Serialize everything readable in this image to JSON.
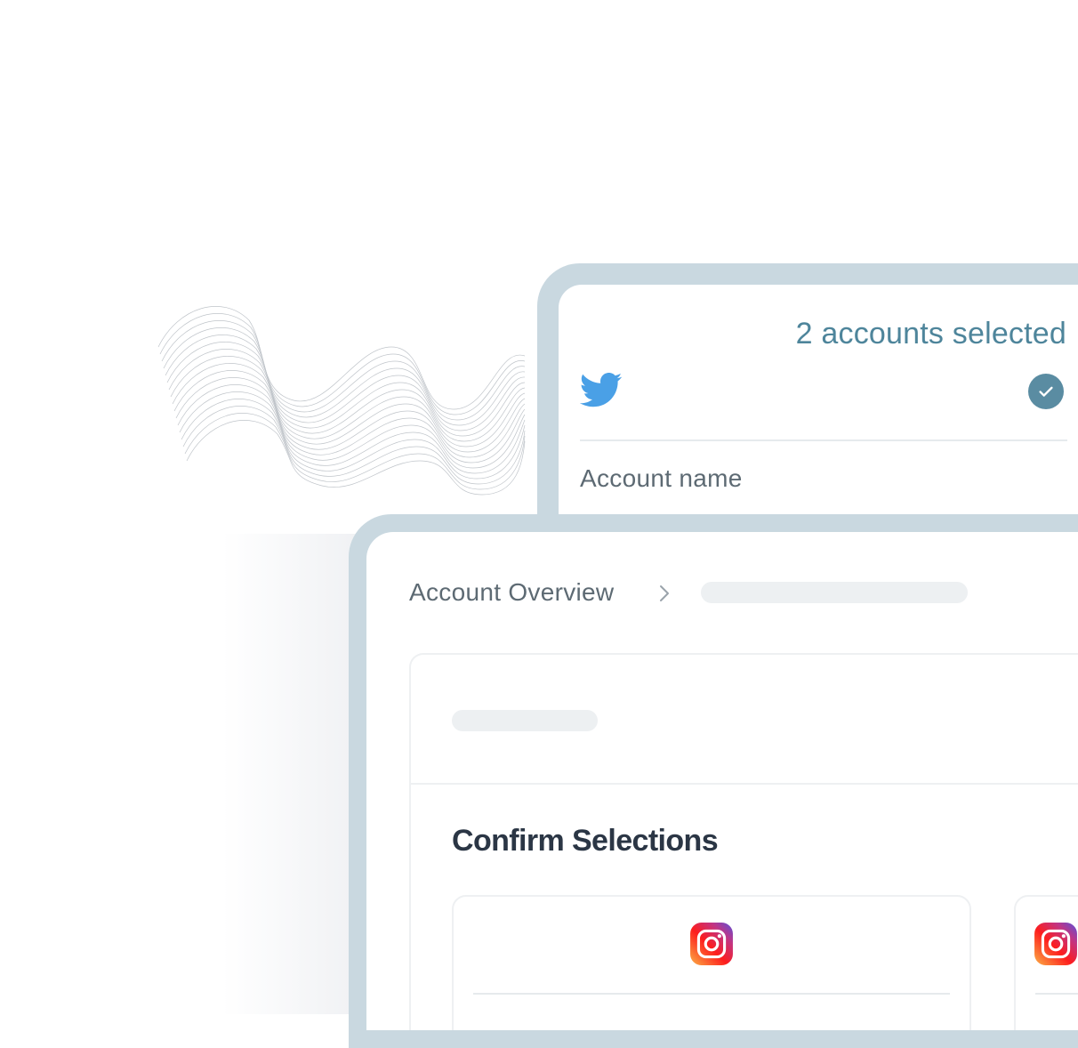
{
  "account_selector": {
    "selected_count_label": "2 accounts selected",
    "platform_icon": "twitter-bird-icon",
    "selected_icon": "checkmark-circle-icon",
    "account_name_label": "Account name"
  },
  "overview": {
    "breadcrumb": {
      "root_label": "Account Overview",
      "separator_icon": "chevron-right-icon"
    },
    "section_title": "Confirm Selections",
    "selection_cards": [
      {
        "platform_icon": "instagram-icon"
      },
      {
        "platform_icon": "instagram-icon"
      }
    ]
  },
  "colors": {
    "frame": "#c9d8e0",
    "accent_text": "#4e859b",
    "check_badge": "#5a8ca2",
    "twitter": "#4aa0e6",
    "body_text": "#5d6a73",
    "title_text": "#2b3645",
    "skeleton": "#edf0f2"
  }
}
